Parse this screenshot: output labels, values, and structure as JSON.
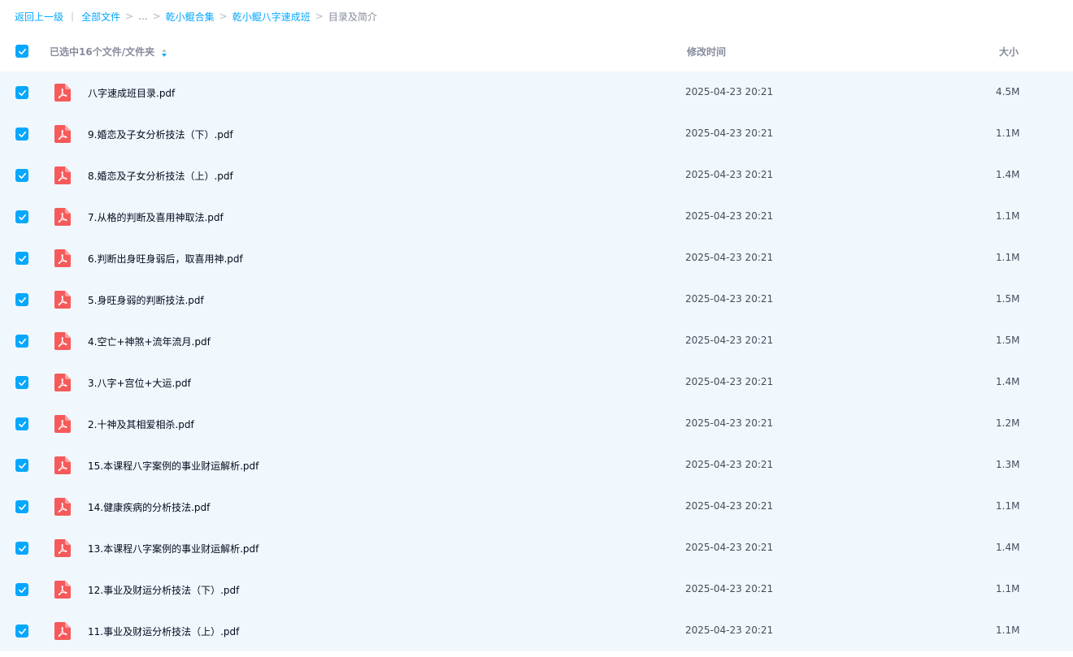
{
  "breadcrumb": {
    "back": "返回上一级",
    "all_files": "全部文件",
    "ellipsis": "...",
    "level1": "乾小鲲合集",
    "level2": "乾小鲲八字速成班",
    "current": "目录及简介"
  },
  "header": {
    "selection_label": "已选中16个文件/文件夹",
    "time_label": "修改时间",
    "size_label": "大小"
  },
  "colors": {
    "accent": "#06a7ff",
    "row_selected_bg": "#f0f8fe",
    "pdf_icon": "#f75a5a"
  },
  "files": [
    {
      "name": "八字速成班目录.pdf",
      "modified": "2025-04-23 20:21",
      "size": "4.5M",
      "icon": "pdf-icon"
    },
    {
      "name": "9.婚恋及子女分析技法（下）.pdf",
      "modified": "2025-04-23 20:21",
      "size": "1.1M",
      "icon": "pdf-icon"
    },
    {
      "name": "8.婚恋及子女分析技法（上）.pdf",
      "modified": "2025-04-23 20:21",
      "size": "1.4M",
      "icon": "pdf-icon"
    },
    {
      "name": "7.从格的判断及喜用神取法.pdf",
      "modified": "2025-04-23 20:21",
      "size": "1.1M",
      "icon": "pdf-icon"
    },
    {
      "name": "6.判断出身旺身弱后，取喜用神.pdf",
      "modified": "2025-04-23 20:21",
      "size": "1.1M",
      "icon": "pdf-icon"
    },
    {
      "name": "5.身旺身弱的判断技法.pdf",
      "modified": "2025-04-23 20:21",
      "size": "1.5M",
      "icon": "pdf-icon"
    },
    {
      "name": "4.空亡+神煞+流年流月.pdf",
      "modified": "2025-04-23 20:21",
      "size": "1.5M",
      "icon": "pdf-icon"
    },
    {
      "name": "3.八字+宫位+大运.pdf",
      "modified": "2025-04-23 20:21",
      "size": "1.4M",
      "icon": "pdf-icon"
    },
    {
      "name": "2.十神及其相爱相杀.pdf",
      "modified": "2025-04-23 20:21",
      "size": "1.2M",
      "icon": "pdf-icon"
    },
    {
      "name": "15.本课程八字案例的事业财运解析.pdf",
      "modified": "2025-04-23 20:21",
      "size": "1.3M",
      "icon": "pdf-icon"
    },
    {
      "name": "14.健康疾病的分析技法.pdf",
      "modified": "2025-04-23 20:21",
      "size": "1.1M",
      "icon": "pdf-icon"
    },
    {
      "name": "13.本课程八字案例的事业财运解析.pdf",
      "modified": "2025-04-23 20:21",
      "size": "1.4M",
      "icon": "pdf-icon"
    },
    {
      "name": "12.事业及财运分析技法（下）.pdf",
      "modified": "2025-04-23 20:21",
      "size": "1.1M",
      "icon": "pdf-icon"
    },
    {
      "name": "11.事业及财运分析技法（上）.pdf",
      "modified": "2025-04-23 20:21",
      "size": "1.1M",
      "icon": "pdf-icon"
    }
  ]
}
